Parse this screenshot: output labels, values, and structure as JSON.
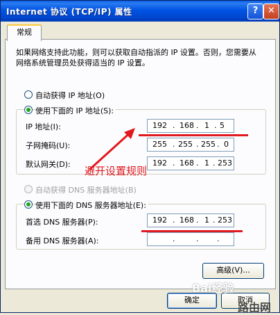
{
  "window": {
    "title": "Internet 协议 (TCP/IP) 属性",
    "help_icon": "?",
    "close_icon": "✕"
  },
  "tabs": [
    {
      "label": "常规"
    }
  ],
  "description": "如果网络支持此功能，则可以获取自动指派的 IP 设置。否则，您需要从网络系统管理员处获得适当的 IP 设置。",
  "ip": {
    "auto_label": "自动获得 IP 地址(O)",
    "manual_label": "使用下面的 IP 地址(S):",
    "fields": [
      {
        "label": "IP 地址(I):",
        "octets": [
          "192",
          "168",
          "1",
          "5"
        ]
      },
      {
        "label": "子网掩码(U):",
        "octets": [
          "255",
          "255",
          "255",
          "0"
        ]
      },
      {
        "label": "默认网关(D):",
        "octets": [
          "192",
          "168",
          "1",
          "253"
        ]
      }
    ]
  },
  "dns": {
    "auto_label": "自动获得 DNS 服务器地址(B)",
    "manual_label": "使用下面的 DNS 服务器地址(E):",
    "fields": [
      {
        "label": "首选 DNS 服务器(P):",
        "octets": [
          "192",
          "168",
          "1",
          "253"
        ]
      },
      {
        "label": "备用 DNS 服务器(A):",
        "octets": [
          "",
          "",
          "",
          ""
        ]
      }
    ]
  },
  "buttons": {
    "advanced": "高级(V)...",
    "ok": "确定",
    "cancel": "取消"
  },
  "annotation": {
    "text": "避开设置规则",
    "color": "#e0191f"
  },
  "watermark": {
    "baidu": "Bai经验",
    "site": "路由网"
  }
}
